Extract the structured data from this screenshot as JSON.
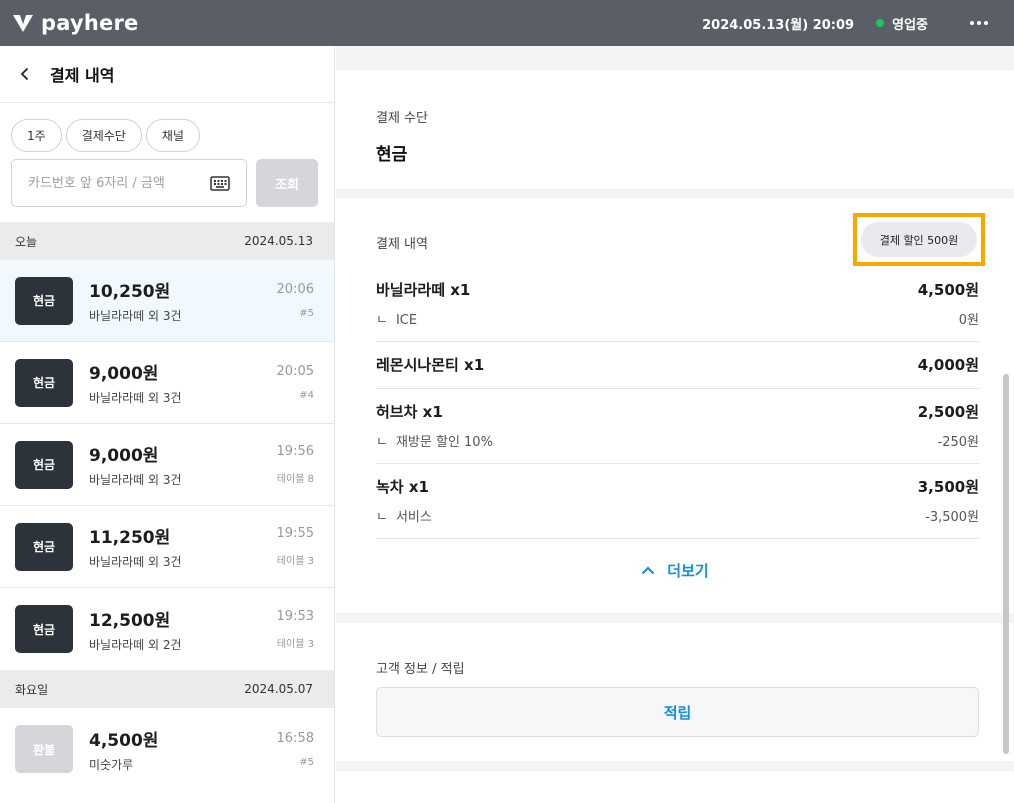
{
  "app": {
    "brand": "payhere"
  },
  "topbar": {
    "datetime": "2024.05.13(월) 20:09",
    "status": "영업중",
    "status_color": "#17c964"
  },
  "left": {
    "title": "결제 내역",
    "chips": [
      "1주",
      "결제수단",
      "채널"
    ],
    "search": {
      "placeholder": "카드번호 앞 6자리 / 금액",
      "value": ""
    },
    "query_label": "조회",
    "groups": [
      {
        "label": "오늘",
        "date": "2024.05.13",
        "items": [
          {
            "badge": "현금",
            "amount": "10,250원",
            "desc": "바닐라라떼 외 3건",
            "time": "20:06",
            "sub": "#5",
            "selected": true,
            "refund": false
          },
          {
            "badge": "현금",
            "amount": "9,000원",
            "desc": "바닐라라떼 외 3건",
            "time": "20:05",
            "sub": "#4",
            "selected": false,
            "refund": false
          },
          {
            "badge": "현금",
            "amount": "9,000원",
            "desc": "바닐라라떼 외 3건",
            "time": "19:56",
            "sub": "테이블 8",
            "selected": false,
            "refund": false
          },
          {
            "badge": "현금",
            "amount": "11,250원",
            "desc": "바닐라라떼 외 3건",
            "time": "19:55",
            "sub": "테이블 3",
            "selected": false,
            "refund": false
          },
          {
            "badge": "현금",
            "amount": "12,500원",
            "desc": "바닐라라떼 외 2건",
            "time": "19:53",
            "sub": "테이블 3",
            "selected": false,
            "refund": false
          }
        ]
      },
      {
        "label": "화요일",
        "date": "2024.05.07",
        "items": [
          {
            "badge": "환불",
            "amount": "4,500원",
            "desc": "미숫가루",
            "time": "16:58",
            "sub": "#5",
            "selected": false,
            "refund": true
          }
        ]
      }
    ]
  },
  "right": {
    "payment_method": {
      "label": "결제 수단",
      "value": "현금"
    },
    "details": {
      "label": "결제 내역",
      "discount_badge": "결제 할인 500원",
      "lines": [
        {
          "name": "바닐라라떼",
          "qty": "x1",
          "price": "4,500원",
          "options": [
            {
              "corner": "ㄴ",
              "name": "ICE",
              "price": "0원"
            }
          ]
        },
        {
          "name": "레몬시나몬티",
          "qty": "x1",
          "price": "4,000원",
          "options": []
        },
        {
          "name": "허브차",
          "qty": "x1",
          "price": "2,500원",
          "options": [
            {
              "corner": "ㄴ",
              "name": "재방문 할인 10%",
              "price": "-250원"
            }
          ]
        },
        {
          "name": "녹차",
          "qty": "x1",
          "price": "3,500원",
          "options": [
            {
              "corner": "ㄴ",
              "name": "서비스",
              "price": "-3,500원"
            }
          ]
        }
      ],
      "more_label": "더보기"
    },
    "customer": {
      "label": "고객 정보 / 적립",
      "earn_label": "적립"
    }
  },
  "colors": {
    "accent": "#1a8fdc",
    "highlight": "#f5a800",
    "badge_dark": "#2d333a",
    "topbar": "#5a5e66"
  }
}
